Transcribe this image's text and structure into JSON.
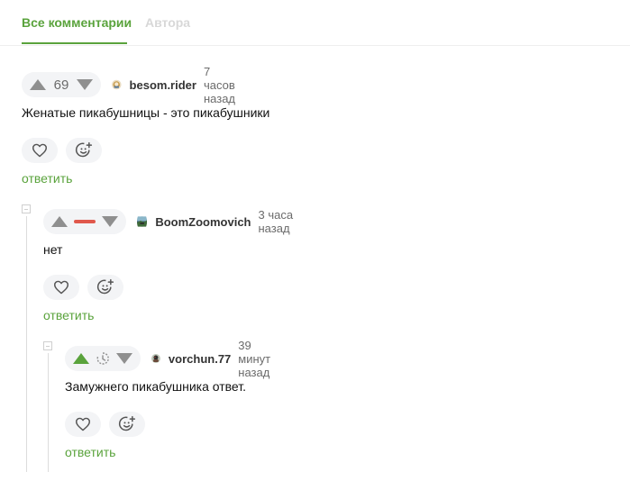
{
  "tabs": {
    "all": "Все комментарии",
    "author": "Автора"
  },
  "comments": [
    {
      "rating": "69",
      "username": "besom.rider",
      "time": "7 часов назад",
      "text": "Женатые пикабушницы - это пикабушники",
      "reply": "ответить",
      "rating_state": "number"
    },
    {
      "rating": "",
      "username": "BoomZoomovich",
      "time": "3 часа назад",
      "text": "нет",
      "reply": "ответить",
      "rating_state": "negative-hidden"
    },
    {
      "rating": "",
      "username": "vorchun.77",
      "time": "39 минут назад",
      "text": "Замужнего пикабушника ответ.",
      "reply": "ответить",
      "rating_state": "pending"
    }
  ],
  "colors": {
    "accent": "#5aa33c",
    "negative": "#e0584c",
    "icon_gray": "#777777"
  }
}
